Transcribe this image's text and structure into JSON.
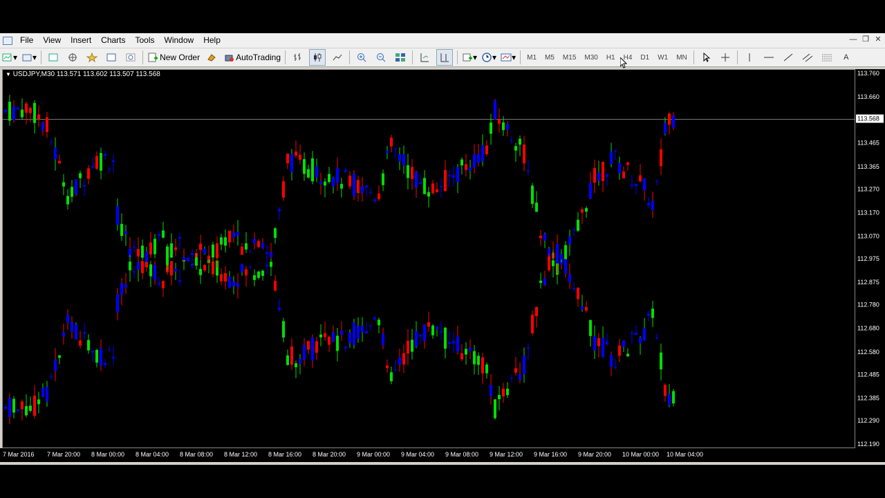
{
  "menubar": {
    "items": [
      "File",
      "View",
      "Insert",
      "Charts",
      "Tools",
      "Window",
      "Help"
    ]
  },
  "toolbar": {
    "new_order": "New Order",
    "autotrading": "AutoTrading",
    "periods": [
      "M1",
      "M5",
      "M15",
      "M30",
      "H1",
      "H4",
      "D1",
      "W1",
      "MN"
    ]
  },
  "chart": {
    "label": "USDJPY,M30  113.571 113.602 113.507 113.568",
    "current_price": "113.568",
    "colors": {
      "bull": "#00e000",
      "bear": "#ff0000",
      "neutral": "#0000ff",
      "background": "#000000",
      "bid_line": "#c0c0c0"
    }
  },
  "chart_data": {
    "type": "candlestick",
    "symbol": "USDJPY",
    "timeframe": "M30",
    "price_axis": [
      "113.760",
      "113.660",
      "113.565",
      "113.465",
      "113.365",
      "113.270",
      "113.170",
      "113.070",
      "112.975",
      "112.875",
      "112.780",
      "112.680",
      "112.580",
      "112.485",
      "112.385",
      "112.290",
      "112.190"
    ],
    "time_axis": [
      "7 Mar 2016",
      "7 Mar 20:00",
      "8 Mar 00:00",
      "8 Mar 04:00",
      "8 Mar 08:00",
      "8 Mar 12:00",
      "8 Mar 16:00",
      "8 Mar 20:00",
      "9 Mar 00:00",
      "9 Mar 04:00",
      "9 Mar 08:00",
      "9 Mar 12:00",
      "9 Mar 16:00",
      "9 Mar 20:00",
      "10 Mar 00:00",
      "10 Mar 04:00"
    ],
    "ylim": [
      112.19,
      113.76
    ]
  }
}
